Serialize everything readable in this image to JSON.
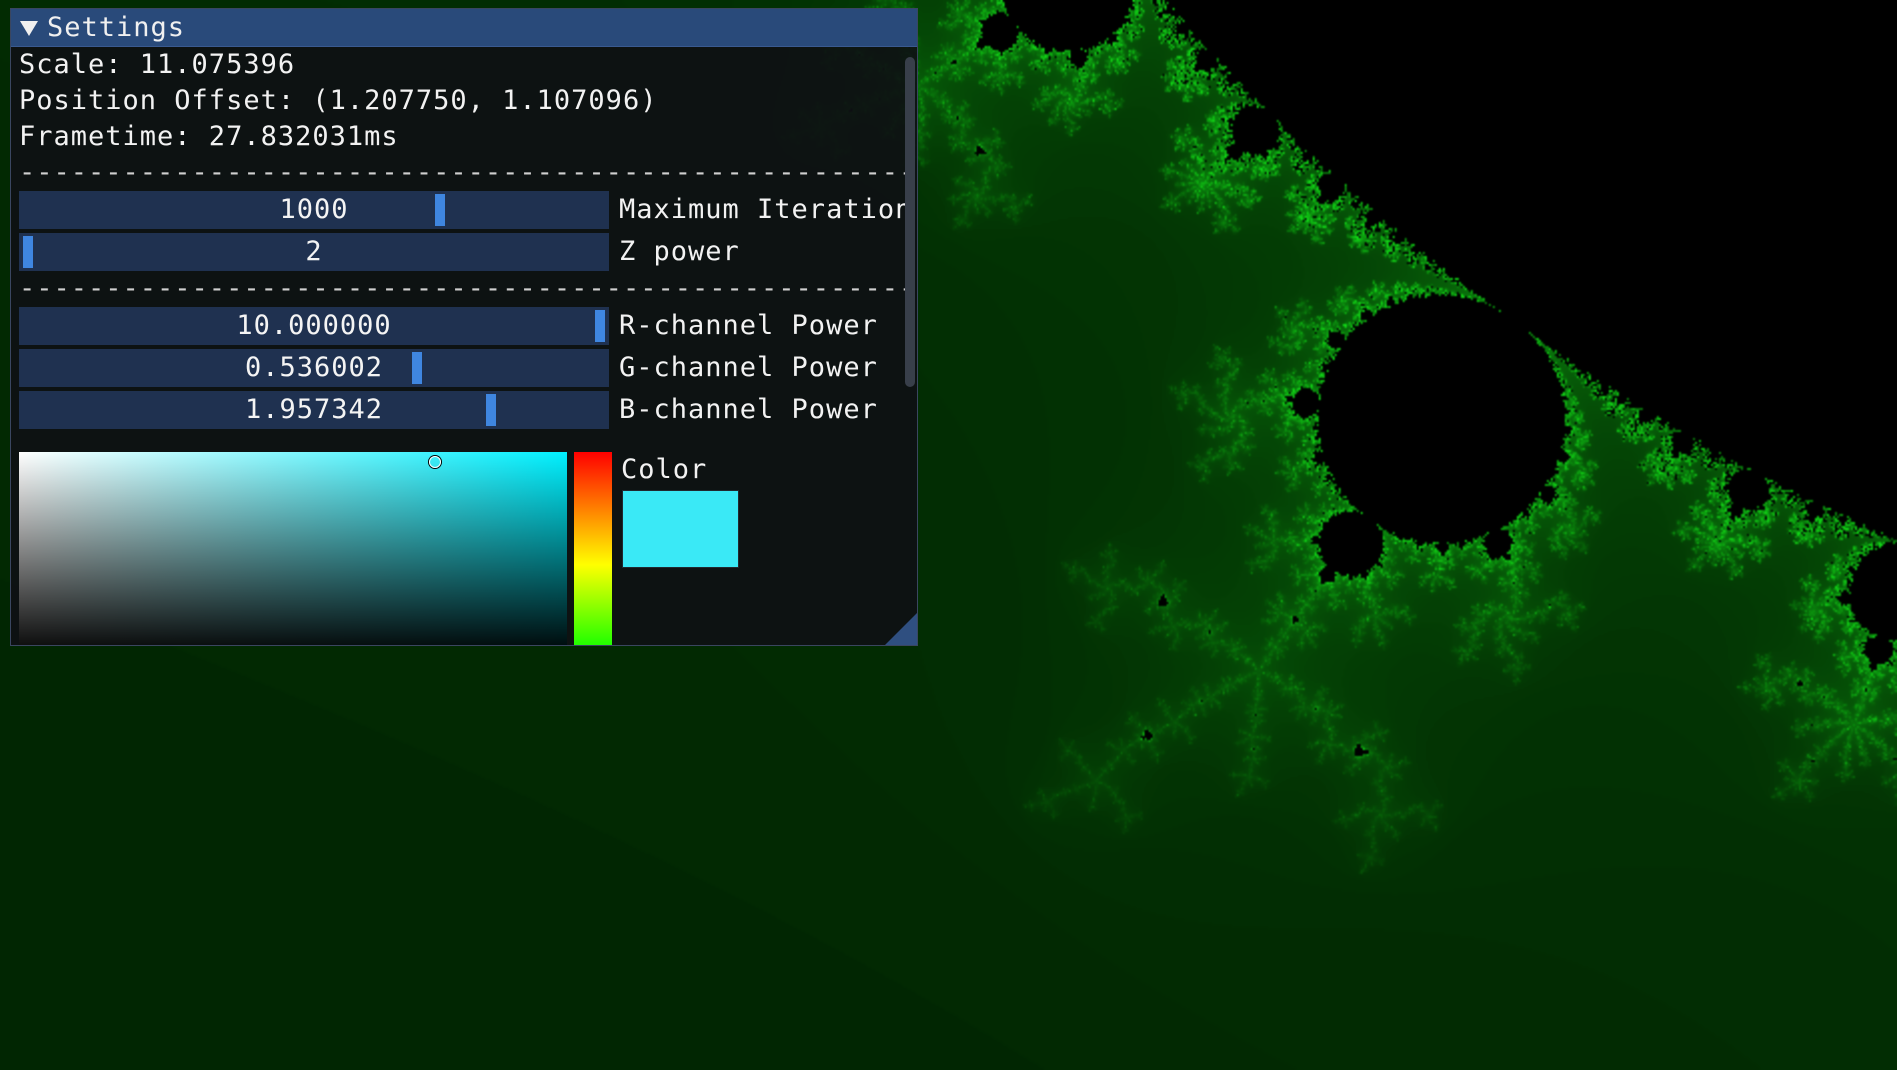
{
  "window": {
    "title": "Settings",
    "collapse_icon": "triangle-down-icon"
  },
  "stats": {
    "scale": "Scale: 11.075396",
    "position_offset": "Position Offset: (1.207750, 1.107096)",
    "frametime": "Frametime: 27.832031ms"
  },
  "separator": "------------------------------------------------------------",
  "iteration_sliders": [
    {
      "value": "1000",
      "label": "Maximum Iteration",
      "level": 0.72
    },
    {
      "value": "2",
      "label": "Z power",
      "level": 0.0
    }
  ],
  "channel_sliders": [
    {
      "value": "10.000000",
      "label": "R-channel Power",
      "level": 1.0
    },
    {
      "value": "0.536002",
      "label": "G-channel Power",
      "level": 0.68
    },
    {
      "value": "1.957342",
      "label": "B-channel Power",
      "level": 0.81
    }
  ],
  "color_picker": {
    "label": "Color",
    "swatch_color": "#3ae9f6",
    "saturation": 0.76,
    "brightness": 0.95
  },
  "colors": {
    "accent": "#3f86e0",
    "titlebar": "#294a7a",
    "slider_bg": "#1f3150",
    "fractal_green": "#2fd23a"
  }
}
